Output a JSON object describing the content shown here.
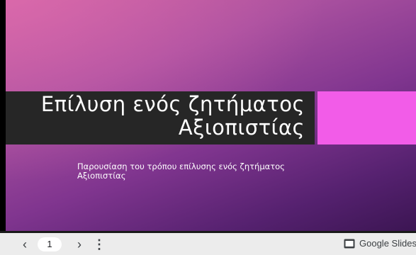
{
  "slide": {
    "title_line1": "Επίλυση ενός ζητήματος",
    "title_line2": "Αξιοπιστίας",
    "subtitle_line1": "Παρουσίαση του τρόπου επίλυσης ενός ζητήματος",
    "subtitle_line2": "Αξιοπιστίας"
  },
  "toolbar": {
    "prev_icon": "‹",
    "page_number": "1",
    "next_icon": "›",
    "menu_icon": "⋮",
    "brand_label": "Google Slides"
  },
  "colors": {
    "title_bar": "#262626",
    "accent_block": "#f25ce8",
    "toolbar_bg": "#ececec"
  },
  "icons": {
    "prev": "chevron-left-icon",
    "next": "chevron-right-icon",
    "menu": "more-vertical-icon",
    "brand": "google-slides-icon"
  }
}
